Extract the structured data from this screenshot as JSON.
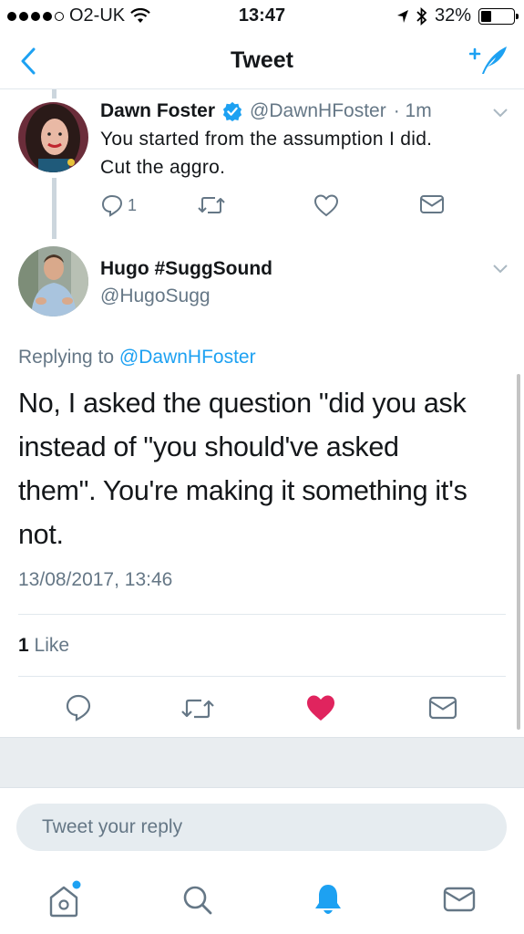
{
  "status_bar": {
    "carrier": "O2-UK",
    "time": "13:47",
    "battery": "32%",
    "battery_level": 0.32
  },
  "nav": {
    "title": "Tweet",
    "back_icon": "chevron-left-icon",
    "compose_icon": "compose-tweet-icon"
  },
  "parent_tweet": {
    "name": "Dawn Foster",
    "handle": "@DawnHFoster",
    "time": "· 1m",
    "text_line1": "You started from the assumption I did.",
    "text_line2": "Cut the aggro.",
    "reply_count": "1"
  },
  "main_tweet": {
    "name": "Hugo #SuggSound",
    "handle": "@HugoSugg",
    "replying_prefix": "Replying to",
    "replying_to": "@DawnHFoster",
    "text_line1": "No, I asked the question \"did you ask",
    "text_line2": "instead of \"you should've asked",
    "text_line3": "them\". You're making it something it's",
    "text_line4": "not.",
    "timestamp": "13/08/2017, 13:46",
    "like_count": "1",
    "like_label": "Like"
  },
  "reply": {
    "placeholder": "Tweet your reply"
  },
  "colors": {
    "accent": "#1da1f2",
    "like": "#e0245e",
    "muted": "#657786"
  }
}
